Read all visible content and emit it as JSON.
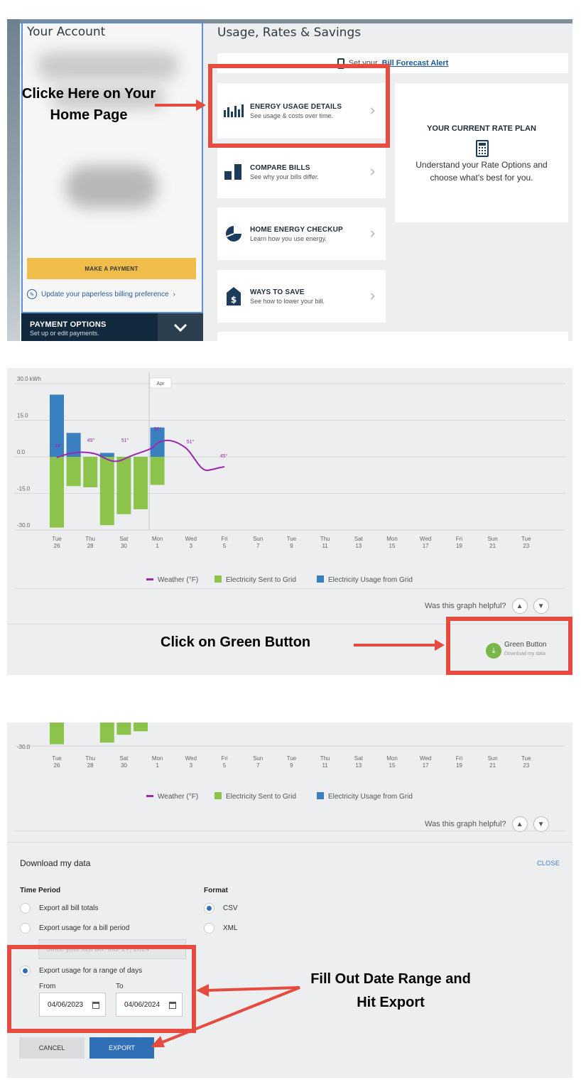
{
  "panel1": {
    "account_title": "Your Account",
    "make_payment": "MAKE A PAYMENT",
    "paperless": "Update your paperless billing preference",
    "payment_options_title": "PAYMENT OPTIONS",
    "payment_options_sub": "Set up or edit payments.",
    "usage_title": "Usage, Rates & Savings",
    "forecast_prefix": "Set your",
    "forecast_link": "Bill Forecast Alert",
    "tiles": [
      {
        "title": "ENERGY USAGE DETAILS",
        "sub": "See usage & costs over time.",
        "icon": "bar-chart-icon"
      },
      {
        "title": "COMPARE BILLS",
        "sub": "See why your bills differ.",
        "icon": "compare-bars-icon"
      },
      {
        "title": "HOME ENERGY CHECKUP",
        "sub": "Learn how you use energy.",
        "icon": "pie-chart-icon"
      },
      {
        "title": "WAYS TO SAVE",
        "sub": "See how to lower your bill.",
        "icon": "dollar-tag-icon"
      }
    ],
    "rate_title": "YOUR CURRENT RATE PLAN",
    "rate_desc": "Understand your Rate Options and choose what's best for you.",
    "annotation": "Clicke Here on Your Home Page"
  },
  "chart_data": {
    "type": "bar",
    "ylabel": "kWh",
    "y_ticks": [
      "30.0 kWh",
      "15.0",
      "0.0",
      "-15.0",
      "-30.0"
    ],
    "ylim": [
      -30,
      30
    ],
    "month_marker": "Apr",
    "x_labels": [
      [
        "Tue",
        "26"
      ],
      [
        "Thu",
        "28"
      ],
      [
        "Sat",
        "30"
      ],
      [
        "Mon",
        "1"
      ],
      [
        "Wed",
        "3"
      ],
      [
        "Fri",
        "5"
      ],
      [
        "Sun",
        "7"
      ],
      [
        "Tue",
        "9"
      ],
      [
        "Thu",
        "11"
      ],
      [
        "Sat",
        "13"
      ],
      [
        "Mon",
        "15"
      ],
      [
        "Wed",
        "17"
      ],
      [
        "Fri",
        "19"
      ],
      [
        "Sun",
        "21"
      ],
      [
        "Tue",
        "23"
      ]
    ],
    "series": [
      {
        "name": "Electricity Sent to Grid",
        "color": "#8cc34b",
        "values": [
          -29,
          -12,
          -12.5,
          -28,
          -23.5,
          -21.5,
          -11.5
        ]
      },
      {
        "name": "Electricity Usage from Grid",
        "color": "#3a7fc0",
        "values": [
          25.5,
          9.8,
          0,
          1.6,
          0,
          0,
          12
        ]
      }
    ],
    "weather": {
      "name": "Weather (°F)",
      "color": "#9c27b0",
      "labels": [
        "48°",
        "49°",
        "51°",
        "56°",
        "51°",
        "45°"
      ]
    }
  },
  "panel2": {
    "helpful": "Was this graph helpful?",
    "green_button_title": "Green Button",
    "green_button_sub": "Download my data",
    "annotation": "Click on Green Button"
  },
  "panel3": {
    "y_tick": "-30.0",
    "helpful": "Was this graph helpful?",
    "title": "Download my data",
    "close": "CLOSE",
    "time_period": "Time Period",
    "format": "Format",
    "opt_all": "Export all bill totals",
    "opt_bill": "Export usage for a bill period",
    "bill_period_placeholder": "Since your last bill: Mar 27, 2024",
    "opt_range": "Export usage for a range of days",
    "from_label": "From",
    "to_label": "To",
    "from_date": "04/06/2023",
    "to_date": "04/06/2024",
    "fmt_csv": "CSV",
    "fmt_xml": "XML",
    "cancel": "CANCEL",
    "export": "EXPORT",
    "annotation": "Fill Out Date Range and Hit Export"
  }
}
